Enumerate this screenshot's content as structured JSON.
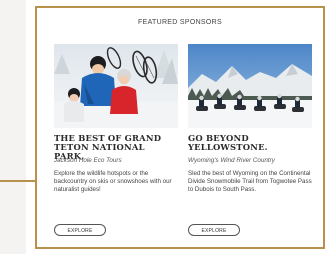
{
  "section": {
    "heading": "FEATURED SPONSORS"
  },
  "colors": {
    "accent_border": "#b8924a",
    "left_panel": "#f4f3f1"
  },
  "cards": [
    {
      "photo_icon": "family-snowshoe-photo",
      "title": "THE BEST OF GRAND TETON NATIONAL PARK.",
      "sponsor": "Jackson Hole Eco Tours",
      "description": "Explore the wildlife hotspots or the backcountry on skis or snowshoes with our naturalist guides!",
      "button_label": "EXPLORE"
    },
    {
      "photo_icon": "snowmobile-group-photo",
      "title": "GO BEYOND YELLOWSTONE.",
      "sponsor": "Wyoming's Wind River Country",
      "description": "Sled the best of Wyoming on the Continental Divide Snowmobile Trail from Togwotee Pass to Dubois to South Pass.",
      "button_label": "EXPLORE"
    }
  ]
}
